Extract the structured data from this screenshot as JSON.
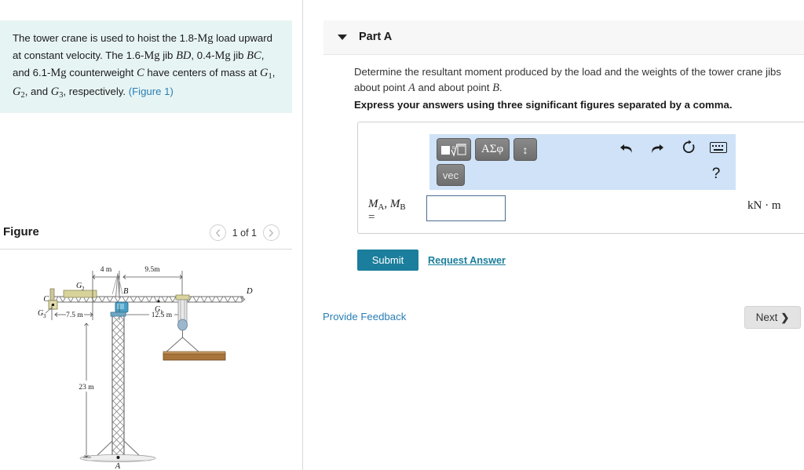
{
  "problem": {
    "line1_a": "The tower crane is used to hoist the 1.8-",
    "mg": "Mg",
    "line1_b": " load upward",
    "line2_a": "at constant velocity. The 1.6-",
    "line2_b": " jib ",
    "jib_bd": "BD",
    "line2_c": ", 0.4-",
    "line2_d": " jib",
    "jib_bc": "BC",
    "line3_b": ", and 6.1-",
    "line3_c": " counterweight ",
    "c_label": "C",
    "line3_d": " have centers of mass",
    "line4_a": "at ",
    "g1": "G",
    "g1s": "1",
    "g2": "G",
    "g2s": "2",
    "g3": "G",
    "g3s": "3",
    "sep1": ", ",
    "sep2": ", and ",
    "line4_b": ", respectively. ",
    "figure_link": "(Figure 1)"
  },
  "figure_panel": {
    "title": "Figure",
    "prev_icon": "chevron-left",
    "next_icon": "chevron-right",
    "pager_label": "1 of 1"
  },
  "figure": {
    "dim_4m": "4 m",
    "dim_95m": "9.5m",
    "dim_75m": "7.5 m",
    "dim_125m": "12.5 m",
    "dim_23m": "23 m",
    "label_A": "A",
    "label_B": "B",
    "label_C": "C",
    "label_D": "D",
    "label_G1": "G",
    "label_G1_sub": "1",
    "label_G2": "G",
    "label_G2_sub": "2",
    "label_G3": "G",
    "label_G3_sub": "3"
  },
  "part": {
    "caret_icon": "caret-down-icon",
    "title": "Part A",
    "question_a": "Determine the resultant moment produced by the load and the weights of the tower crane jibs about point ",
    "question_A": "A",
    "question_b": " and about point ",
    "question_B": "B",
    "question_c": ".",
    "instruction": "Express your answers using three significant figures separated by a comma."
  },
  "math_toolbar": {
    "btn_sqrt": "□ⁿ√□",
    "btn_greek": "ΑΣφ",
    "btn_updown": "↕",
    "btn_vec": "vec",
    "undo_icon": "undo-arrow-icon",
    "redo_icon": "redo-arrow-icon",
    "reset_icon": "reset-circular-arrow-icon",
    "keyboard_icon": "keyboard-icon",
    "help_icon": "?"
  },
  "answer": {
    "label_line1": "M_A, M_B",
    "label_M": "M",
    "label_A_sub": "A",
    "label_comma": ", ",
    "label_B_sub": "B",
    "label_eq": "=",
    "value": "",
    "placeholder": "",
    "units": "kN · m"
  },
  "actions": {
    "submit_label": "Submit",
    "request_answer_label": "Request Answer",
    "provide_feedback_label": "Provide Feedback",
    "next_label": "Next",
    "next_icon": "chevron-right-icon"
  },
  "colors": {
    "accent_teal": "#1b7e9c",
    "link_blue": "#2a7fb5",
    "problem_bg": "#e7f4f4",
    "toolbar_bg": "#cfe2f7"
  }
}
